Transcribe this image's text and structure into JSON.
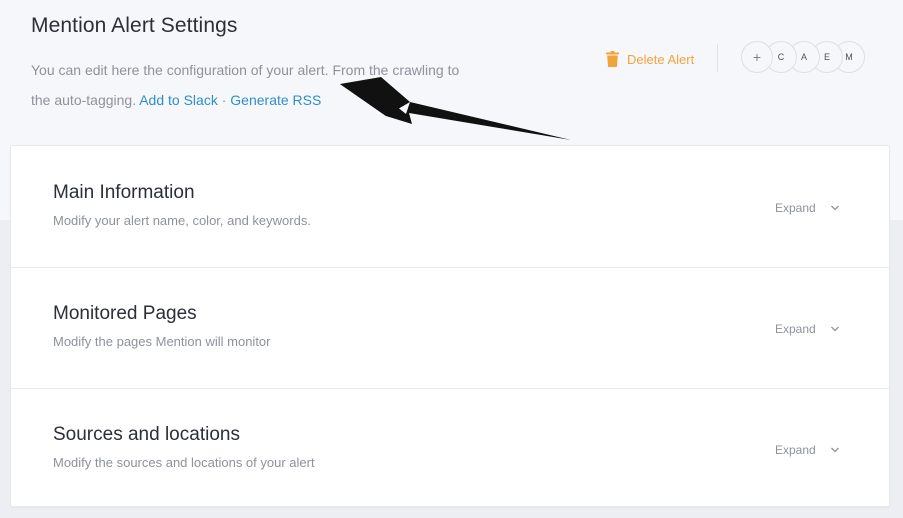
{
  "header": {
    "title": "Mention Alert Settings",
    "description": "You can edit here the configuration of your alert. From the crawling to the auto-tagging.",
    "add_to_slack": "Add to Slack",
    "separator": "·",
    "generate_rss": "Generate RSS",
    "delete_alert": "Delete Alert",
    "add_member": "+",
    "avatars": [
      "C",
      "A",
      "E",
      "M"
    ]
  },
  "sections": [
    {
      "title": "Main Information",
      "subtitle": "Modify your alert name, color, and keywords.",
      "expand_label": "Expand"
    },
    {
      "title": "Monitored Pages",
      "subtitle": "Modify the pages Mention will monitor",
      "expand_label": "Expand"
    },
    {
      "title": "Sources and locations",
      "subtitle": "Modify the sources and locations of your alert",
      "expand_label": "Expand"
    }
  ],
  "colors": {
    "accent_link": "#2e8fcb",
    "delete_orange": "#f2a33a",
    "title_text": "#2b2f38",
    "muted_text": "#8d929b"
  }
}
